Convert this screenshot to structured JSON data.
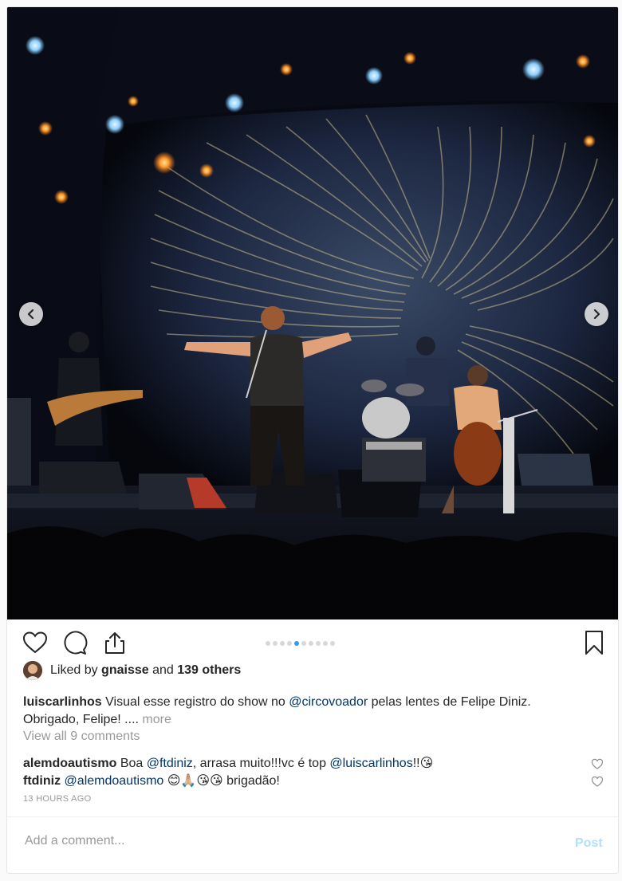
{
  "post": {
    "carousel": {
      "total": 10,
      "active_index": 4
    },
    "liked_by": {
      "prefix": "Liked by",
      "user": "gnaisse",
      "and": "and",
      "count_text": "139 others"
    },
    "caption": {
      "username": "luiscarlinhos",
      "text_1": "Visual esse registro do show no",
      "mention": "@circovoador",
      "text_2": "pelas lentes de Felipe Diniz. Obrigado, Felipe! ....",
      "more": "more"
    },
    "view_all": "View all 9 comments",
    "comments": [
      {
        "username": "alemdoautismo",
        "t1": "Boa",
        "m1": "@ftdiniz",
        "t2": ", arrasa muito!!!vc é top",
        "m2": "@luiscarlinhos",
        "t3": "!!😘"
      },
      {
        "username": "ftdiniz",
        "m1": "@alemdoautismo",
        "t2": "😊🙏🏼😘😘 brigadão!"
      }
    ],
    "timestamp": "13 HOURS AGO",
    "add_comment_placeholder": "Add a comment...",
    "post_label": "Post"
  },
  "colors": {
    "link": "#003569",
    "accent": "#3897f0",
    "muted": "#999999",
    "post_disabled": "#b2dffc"
  },
  "icons": [
    "chevron-left-icon",
    "chevron-right-icon",
    "heart-icon",
    "comment-icon",
    "share-icon",
    "bookmark-icon",
    "small-heart-icon"
  ]
}
